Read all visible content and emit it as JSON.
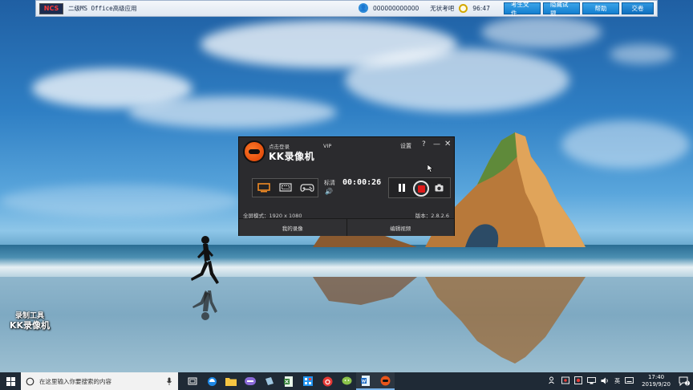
{
  "exam_bar": {
    "logo": "NCS",
    "title": "二级MS Office高级应用",
    "account": "000000000000",
    "account_status": "无状考吧",
    "time": "96:47",
    "buttons": [
      "考生文件",
      "隐藏试题",
      "帮助",
      "交卷"
    ]
  },
  "kk": {
    "login": "点击登录",
    "name": "KK录像机",
    "vip": "VIP",
    "settings": "设置",
    "help": "?",
    "minimize": "—",
    "close": "✕",
    "quality": "标清",
    "volume_icon": "🔊",
    "timer": "00:00:26",
    "mode_text": "全屏模式：1920 x 1080",
    "version": "版本：2.8.2.6",
    "tabs": [
      "我的录像",
      "编辑视频"
    ]
  },
  "watermark": {
    "line1": "录制工具",
    "line2": "KK录像机"
  },
  "taskbar": {
    "search_placeholder": "在这里输入你要搜索的内容",
    "time": "17:40",
    "date": "2019/9/20",
    "ime": "英",
    "notification_count": "2"
  },
  "colors": {
    "exam_button": "#137fd0",
    "kk_bg": "#2b2b2e",
    "record_red": "#e01a1a",
    "taskbar": "#1f2a36"
  }
}
